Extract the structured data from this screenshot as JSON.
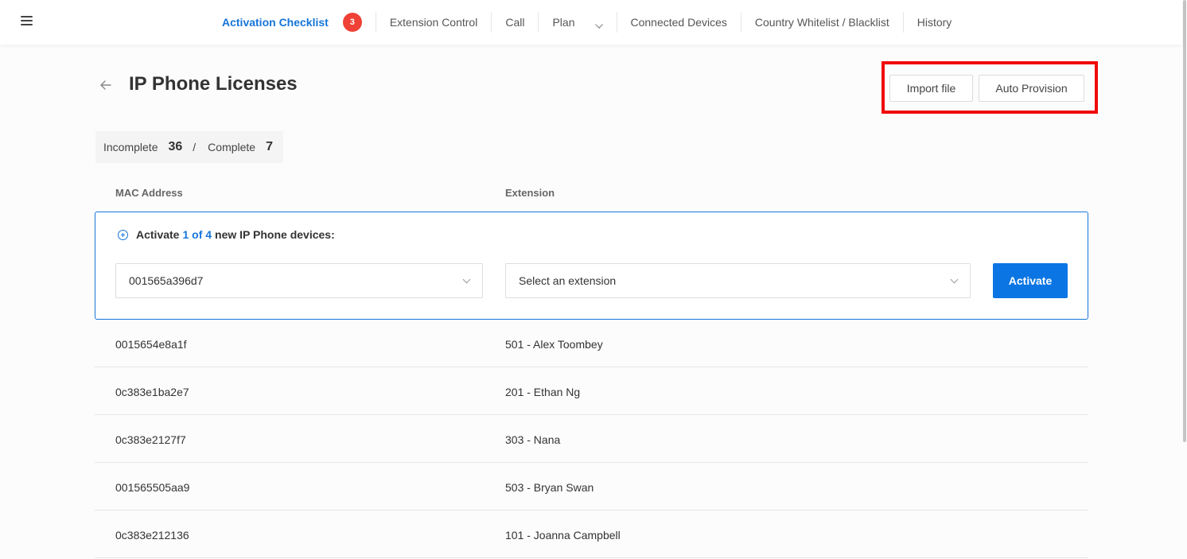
{
  "topnav": {
    "menu_icon": "hamburger-menu-icon",
    "items": [
      {
        "label": "Activation Checklist",
        "active": true,
        "badge": "3"
      },
      {
        "label": "Extension Control"
      },
      {
        "label": "Call"
      },
      {
        "label": "Plan",
        "has_dropdown": true
      },
      {
        "label": "Connected Devices"
      },
      {
        "label": "Country Whitelist / Blacklist"
      },
      {
        "label": "History"
      }
    ]
  },
  "header": {
    "back_icon": "arrow-left-icon",
    "title": "IP Phone Licenses",
    "buttons": {
      "import": "Import file",
      "auto_provision": "Auto Provision"
    }
  },
  "summary": {
    "incomplete_label": "Incomplete",
    "incomplete_count": "36",
    "separator": "/",
    "complete_label": "Complete",
    "complete_count": "7"
  },
  "table": {
    "headers": {
      "mac": "MAC Address",
      "extension": "Extension"
    },
    "activate_card": {
      "prefix": "Activate",
      "progress": "1 of 4",
      "suffix": "new IP Phone devices:",
      "mac_value": "001565a396d7",
      "extension_placeholder": "Select an extension",
      "activate_label": "Activate"
    },
    "rows": [
      {
        "mac": "0015654e8a1f",
        "extension": "501 - Alex Toombey"
      },
      {
        "mac": "0c383e1ba2e7",
        "extension": "201 - Ethan Ng"
      },
      {
        "mac": "0c383e2127f7",
        "extension": "303 - Nana"
      },
      {
        "mac": "001565505aa9",
        "extension": "503 - Bryan Swan"
      },
      {
        "mac": "0c383e212136",
        "extension": "101 - Joanna Campbell"
      }
    ]
  },
  "colors": {
    "accent": "#1675d9",
    "primary_button": "#0b75e3",
    "badge": "#ef4135",
    "highlight": "#f00a0a"
  }
}
